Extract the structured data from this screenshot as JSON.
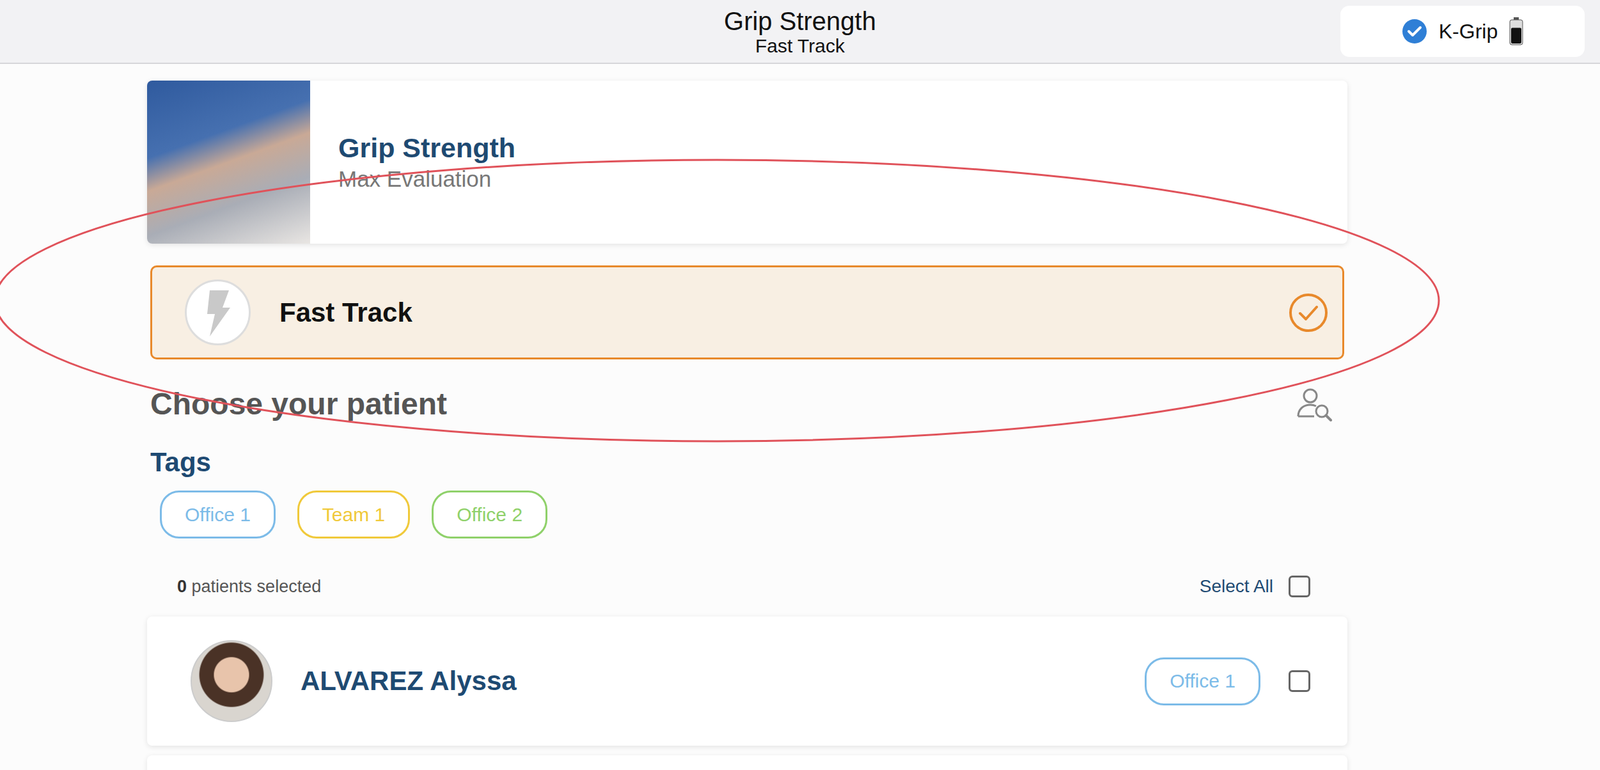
{
  "header": {
    "title": "Grip Strength",
    "subtitle": "Fast Track",
    "device": {
      "name": "K-Grip",
      "connected": true,
      "battery_level": 0.7
    }
  },
  "exercise": {
    "title": "Grip Strength",
    "subtitle": "Max Evaluation"
  },
  "mode": {
    "label": "Fast Track",
    "selected": true
  },
  "patients_section": {
    "title": "Choose your patient"
  },
  "tags": {
    "title": "Tags",
    "items": [
      {
        "label": "Office 1",
        "color": "#7cbbe8"
      },
      {
        "label": "Team 1",
        "color": "#f0c93a"
      },
      {
        "label": "Office 2",
        "color": "#8fd16a"
      }
    ]
  },
  "selection": {
    "count": "0",
    "count_label": "patients selected",
    "select_all_label": "Select All",
    "select_all_checked": false
  },
  "patients": [
    {
      "name": "ALVAREZ Alyssa",
      "tag": "Office 1",
      "tag_color": "#7cbbe8",
      "selected": false
    }
  ]
}
